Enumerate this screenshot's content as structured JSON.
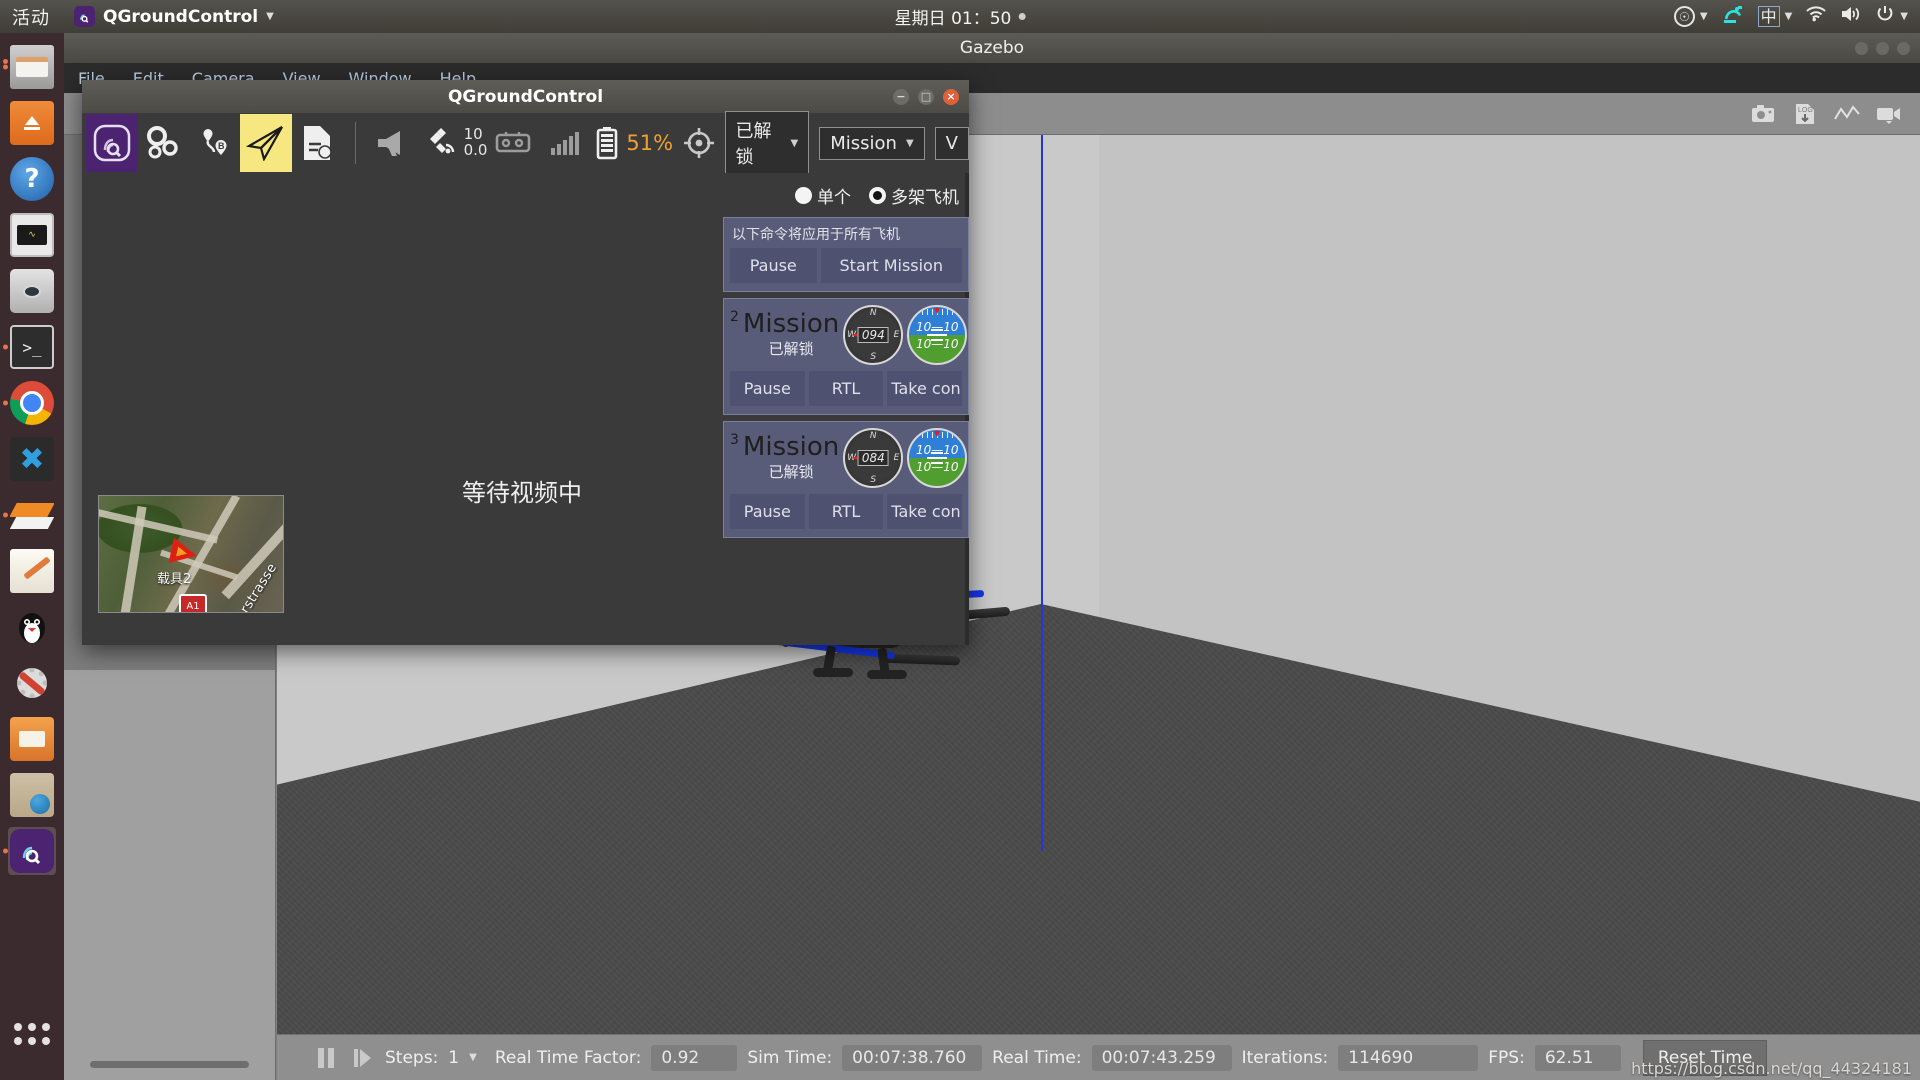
{
  "desktop": {
    "activities": "活动",
    "app_menu_name": "QGroundControl",
    "clock": "星期日 01：50",
    "tray": {
      "accessibility": "accessibility-icon",
      "ibus": "ibus-icon",
      "language": "中",
      "wifi": "wifi-icon",
      "volume": "volume-icon",
      "power": "power-icon"
    },
    "launcher": [
      {
        "name": "files",
        "label": "Files"
      },
      {
        "name": "amazon",
        "label": "Amazon"
      },
      {
        "name": "help",
        "label": "Help"
      },
      {
        "name": "system-monitor",
        "label": "System Monitor"
      },
      {
        "name": "camera",
        "label": "Cheese"
      },
      {
        "name": "terminal",
        "label": "Terminal"
      },
      {
        "name": "chrome",
        "label": "Google Chrome"
      },
      {
        "name": "vscode",
        "label": "Visual Studio Code"
      },
      {
        "name": "slack",
        "label": "Slack"
      },
      {
        "name": "text-editor",
        "label": "Text Editor"
      },
      {
        "name": "qq",
        "label": "QQ"
      },
      {
        "name": "tweak-tool",
        "label": "Tweaks"
      },
      {
        "name": "file-manager",
        "label": "File Manager"
      },
      {
        "name": "browser",
        "label": "Browser"
      },
      {
        "name": "qgroundcontrol",
        "label": "QGroundControl"
      }
    ],
    "show_apps": "show-applications"
  },
  "gazebo": {
    "title": "Gazebo",
    "menus": [
      "File",
      "Edit",
      "Camera",
      "View",
      "Window",
      "Help"
    ],
    "toolbar_icons": [
      "screenshot-icon",
      "log-download-icon",
      "plot-icon",
      "video-record-icon"
    ],
    "statusbar": {
      "pause_icon": "pause-icon",
      "step_icon": "step-forward-icon",
      "steps_label": "Steps:",
      "steps_value": "1",
      "rtf_label": "Real Time Factor:",
      "rtf_value": "0.92",
      "sim_time_label": "Sim Time:",
      "sim_time_value": "00:07:38.760",
      "real_time_label": "Real Time:",
      "real_time_value": "00:07:43.259",
      "iterations_label": "Iterations:",
      "iterations_value": "114690",
      "fps_label": "FPS:",
      "fps_value": "62.51",
      "reset_time_label": "Reset Time"
    }
  },
  "watermark": "https://blog.csdn.net/qq_44324181",
  "qgc": {
    "title": "QGroundControl",
    "toolbar": {
      "app_icon": "qgroundcontrol-logo-icon",
      "settings_icon": "gears-settings-icon",
      "plan_icon": "waypoint-plan-icon",
      "fly_icon": "paper-plane-fly-icon",
      "analyze_icon": "analyze-document-icon",
      "message_icon": "megaphone-message-icon",
      "gps_icon": "satellite-gps-icon",
      "gps_count": "10",
      "gps_hdop": "0.0",
      "rc_icon": "rc-controller-icon",
      "signal_icon": "signal-bars-icon",
      "battery_icon": "battery-icon",
      "battery_value": "51%",
      "mode_icon": "crosshair-mode-icon",
      "arm_state": "已解锁",
      "flight_mode": "Mission",
      "third_combo": "V"
    },
    "video": {
      "waiting_text": "等待视频中"
    },
    "map_thumb": {
      "vehicle_label": "载具2",
      "street_label": "rstrasse",
      "sign_label": "A1"
    },
    "multivehicle": {
      "radio_single": "单个",
      "radio_multi": "多架飞机",
      "radio_selected": "multi",
      "all_header": "以下命令将应用于所有飞机",
      "all_buttons": [
        "Pause",
        "Start Mission"
      ],
      "vehicles": [
        {
          "id": "2",
          "mode": "Mission",
          "arm_state": "已解锁",
          "heading": "094",
          "altitude_left": "10",
          "altitude_right": "10",
          "speed_left": "10",
          "speed_right": "10",
          "buttons": [
            "Pause",
            "RTL",
            "Take con"
          ]
        },
        {
          "id": "3",
          "mode": "Mission",
          "arm_state": "已解锁",
          "heading": "084",
          "altitude_left": "10",
          "altitude_right": "10",
          "speed_left": "10",
          "speed_right": "10",
          "buttons": [
            "Pause",
            "RTL",
            "Take con"
          ]
        }
      ]
    }
  },
  "colors": {
    "qgc_purple": "#4b2370",
    "qgc_yellow": "#f6e781",
    "battery_orange": "#f0a030",
    "panel_blue": "#595c79",
    "axis_blue": "#2734d8",
    "marker_red": "#e01f13"
  }
}
